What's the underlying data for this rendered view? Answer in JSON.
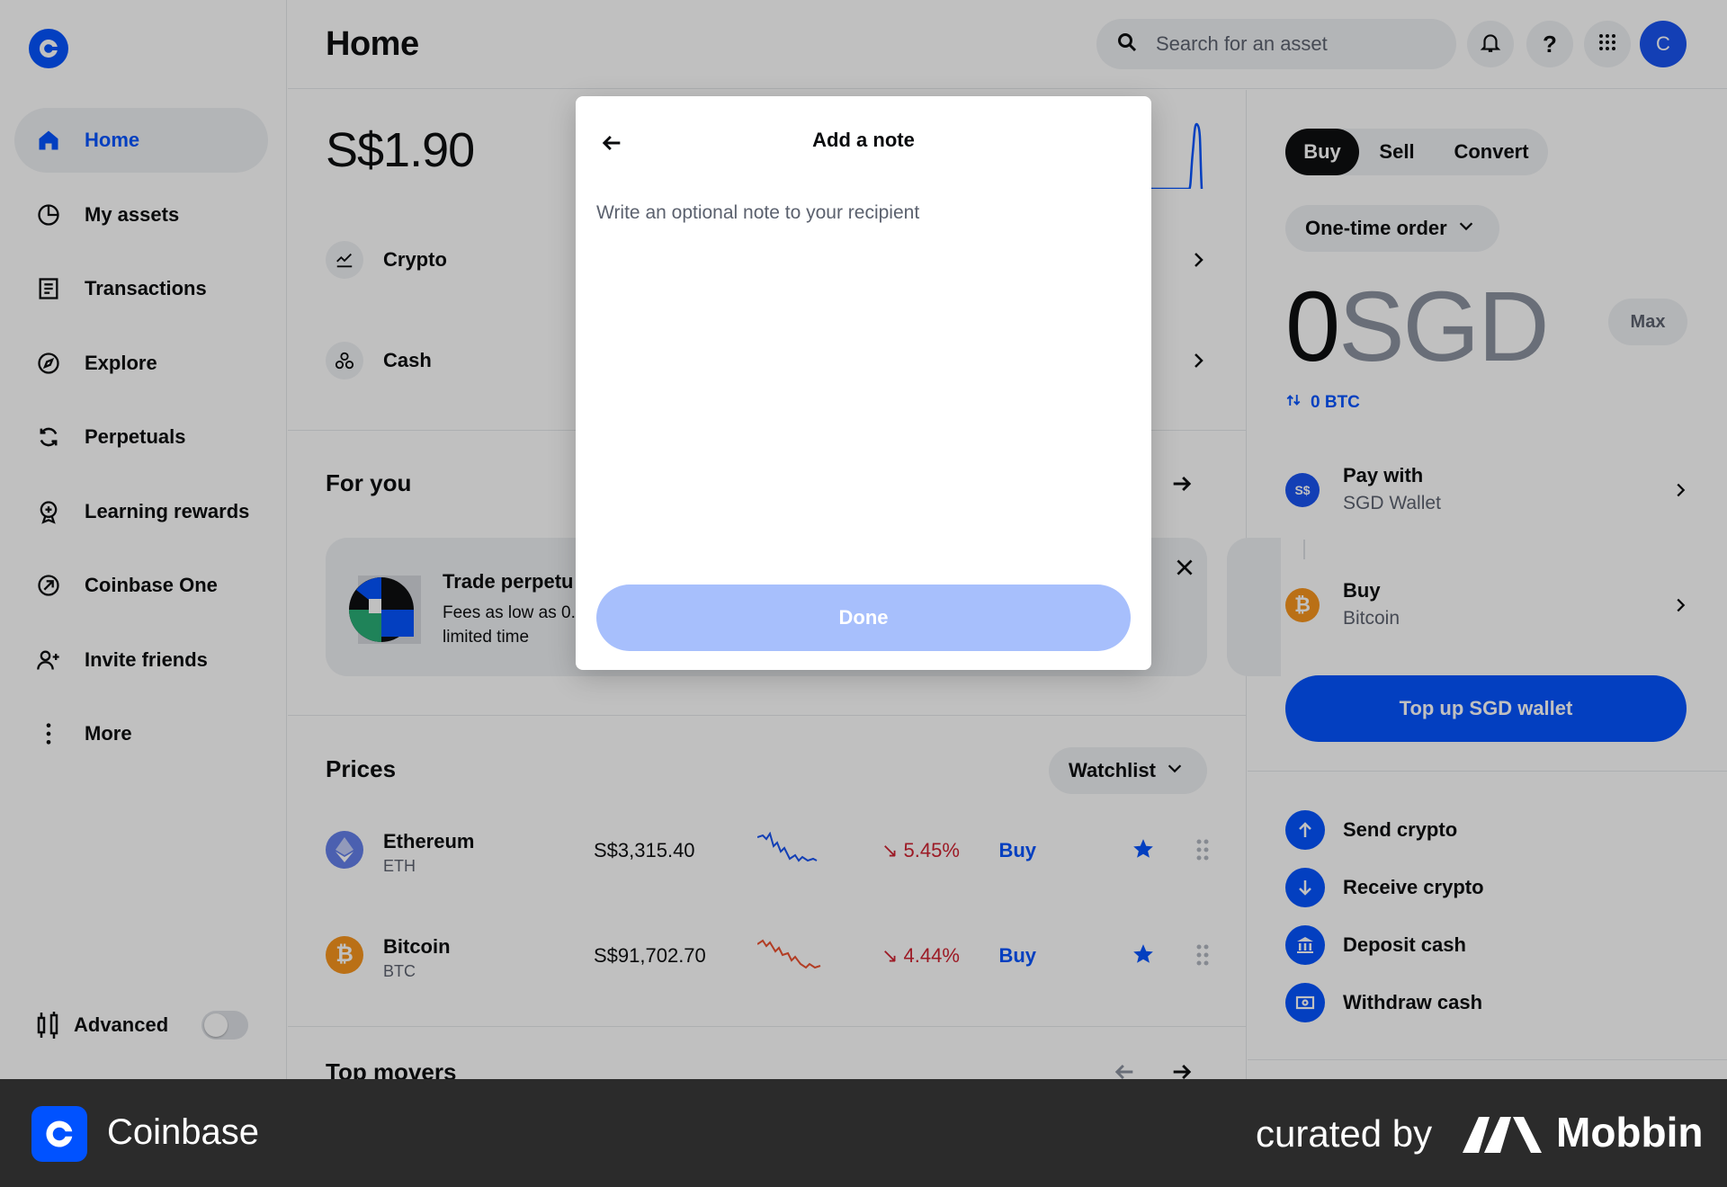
{
  "sidebar": {
    "items": [
      {
        "label": "Home",
        "icon": "home-icon",
        "active": true
      },
      {
        "label": "My assets",
        "icon": "pie-chart-icon"
      },
      {
        "label": "Transactions",
        "icon": "receipt-icon"
      },
      {
        "label": "Explore",
        "icon": "compass-icon"
      },
      {
        "label": "Perpetuals",
        "icon": "refresh-icon"
      },
      {
        "label": "Learning rewards",
        "icon": "award-icon"
      },
      {
        "label": "Coinbase One",
        "icon": "coinbase-one-icon"
      },
      {
        "label": "Invite friends",
        "icon": "add-user-icon"
      },
      {
        "label": "More",
        "icon": "more-vertical-icon"
      }
    ],
    "advanced_label": "Advanced",
    "advanced_on": false
  },
  "header": {
    "title": "Home",
    "search_placeholder": "Search for an asset",
    "avatar_initial": "C"
  },
  "main": {
    "balance": "S$1.90",
    "rows": [
      {
        "label": "Crypto",
        "icon": "chart-line-icon"
      },
      {
        "label": "Cash",
        "icon": "cash-icon"
      }
    ],
    "for_you": {
      "title": "For you",
      "card_title": "Trade perpetu",
      "card_sub": "Fees as low as 0. limited time"
    },
    "prices": {
      "title": "Prices",
      "filter": "Watchlist",
      "assets": [
        {
          "name": "Ethereum",
          "symbol": "ETH",
          "price": "S$3,315.40",
          "change": "↘ 5.45%",
          "buy": "Buy",
          "color": "#627eea"
        },
        {
          "name": "Bitcoin",
          "symbol": "BTC",
          "price": "S$91,702.70",
          "change": "↘ 4.44%",
          "buy": "Buy",
          "color": "#f7931a"
        }
      ]
    },
    "top_movers": "Top movers"
  },
  "trade": {
    "tabs": [
      "Buy",
      "Sell",
      "Convert"
    ],
    "order_type": "One-time order",
    "amount": "0",
    "currency": "SGD",
    "max_label": "Max",
    "btc_equiv": "0 BTC",
    "pay_with": {
      "label": "Pay with",
      "value": "SGD Wallet",
      "badge": "S$"
    },
    "buy_asset": {
      "label": "Buy",
      "value": "Bitcoin"
    },
    "cta": "Top up SGD wallet"
  },
  "actions": [
    {
      "label": "Send crypto",
      "icon": "arrow-up-icon"
    },
    {
      "label": "Receive crypto",
      "icon": "arrow-down-icon"
    },
    {
      "label": "Deposit cash",
      "icon": "bank-icon"
    },
    {
      "label": "Withdraw cash",
      "icon": "banknote-icon"
    }
  ],
  "modal": {
    "title": "Add a note",
    "placeholder": "Write an optional note to your recipient",
    "done_label": "Done"
  },
  "footer": {
    "brand": "Coinbase",
    "curated": "curated by",
    "mobbin": "Mobbin"
  },
  "colors": {
    "accent": "#0052ff",
    "negative": "#cf202f",
    "done_disabled": "#a7bffc"
  }
}
